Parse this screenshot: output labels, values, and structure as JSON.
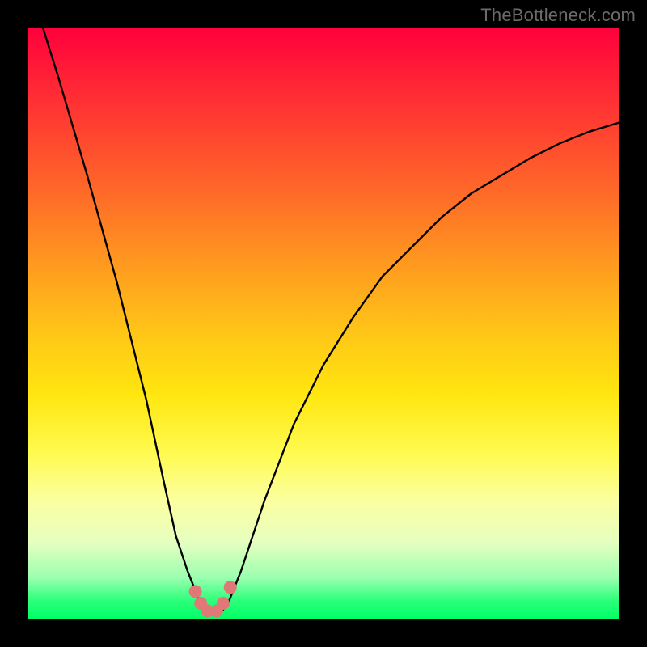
{
  "watermark": "TheBottleneck.com",
  "chart_data": {
    "type": "line",
    "title": "",
    "xlabel": "",
    "ylabel": "",
    "xlim": [
      0,
      100
    ],
    "ylim": [
      0,
      100
    ],
    "grid": false,
    "legend": false,
    "series": [
      {
        "name": "bottleneck-curve",
        "x": [
          0,
          5,
          10,
          15,
          20,
          23,
          25,
          27,
          29,
          30,
          31,
          32,
          33,
          34,
          36,
          40,
          45,
          50,
          55,
          60,
          65,
          70,
          75,
          80,
          85,
          90,
          95,
          100
        ],
        "y": [
          108,
          92,
          75,
          57,
          37,
          23,
          14,
          8,
          3,
          1.5,
          1,
          1,
          1.5,
          3,
          8,
          20,
          33,
          43,
          51,
          58,
          63,
          68,
          72,
          75,
          78,
          80.5,
          82.5,
          84
        ]
      }
    ],
    "markers": [
      {
        "name": "dip-marker",
        "x": 28.3,
        "y": 4.6
      },
      {
        "name": "dip-marker",
        "x": 29.2,
        "y": 2.6
      },
      {
        "name": "dip-marker",
        "x": 30.4,
        "y": 1.3
      },
      {
        "name": "dip-marker",
        "x": 31.9,
        "y": 1.3
      },
      {
        "name": "dip-marker",
        "x": 33.0,
        "y": 2.6
      },
      {
        "name": "dip-marker",
        "x": 34.2,
        "y": 5.3
      }
    ],
    "background_gradient": {
      "top": "#ff003c",
      "upper_mid": "#ffb000",
      "lower_mid": "#fff760",
      "bottom": "#00ff66"
    },
    "curve_color": "#000000",
    "marker_color": "#e07878"
  }
}
